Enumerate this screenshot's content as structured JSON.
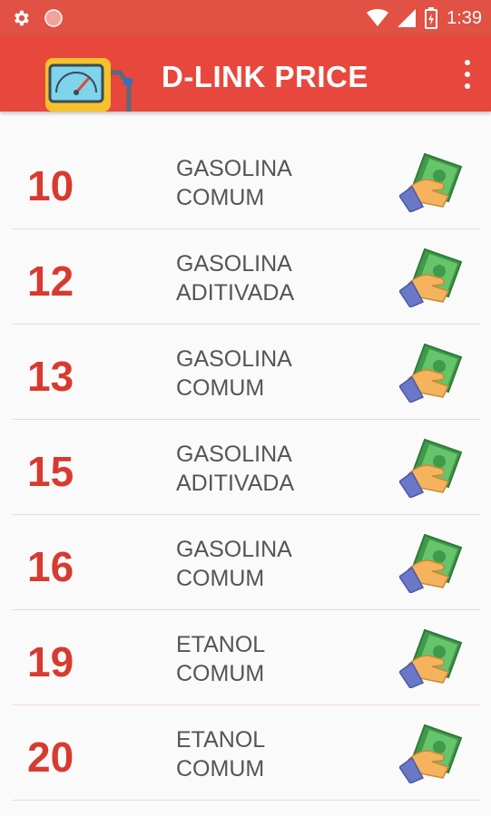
{
  "status_bar": {
    "time": "1:39"
  },
  "app_bar": {
    "title": "D-LINK PRICE"
  },
  "items": [
    {
      "number": "10",
      "fuel_line1": "GASOLINA",
      "fuel_line2": "COMUM"
    },
    {
      "number": "12",
      "fuel_line1": "GASOLINA",
      "fuel_line2": "ADITIVADA"
    },
    {
      "number": "13",
      "fuel_line1": "GASOLINA",
      "fuel_line2": "COMUM"
    },
    {
      "number": "15",
      "fuel_line1": "GASOLINA",
      "fuel_line2": "ADITIVADA"
    },
    {
      "number": "16",
      "fuel_line1": "GASOLINA",
      "fuel_line2": "COMUM"
    },
    {
      "number": "19",
      "fuel_line1": "ETANOL",
      "fuel_line2": "COMUM"
    },
    {
      "number": "20",
      "fuel_line1": "ETANOL",
      "fuel_line2": "COMUM"
    }
  ],
  "colors": {
    "primary": "#e8473d",
    "status_bar": "#e15144",
    "number": "#d83a30",
    "divider": "#f2d6cf"
  },
  "icons": [
    "gear-icon",
    "record-icon",
    "wifi-icon",
    "signal-icon",
    "battery-charging-icon",
    "fuel-pump-gauge-logo",
    "overflow-menu-icon",
    "hand-money-icon"
  ]
}
